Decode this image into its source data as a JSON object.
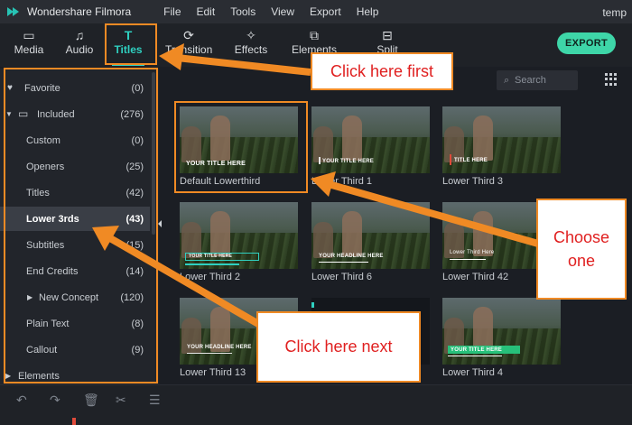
{
  "app": {
    "name": "Wondershare Filmora",
    "project": "temp",
    "menu": [
      "File",
      "Edit",
      "Tools",
      "View",
      "Export",
      "Help"
    ]
  },
  "toolbar": {
    "tabs": [
      {
        "label": "Media",
        "icon": "media-folder-icon"
      },
      {
        "label": "Audio",
        "icon": "music-note-icon"
      },
      {
        "label": "Titles",
        "icon": "text-t-icon",
        "active": true
      },
      {
        "label": "Transition",
        "icon": "transition-icon"
      },
      {
        "label": "Effects",
        "icon": "sparkle-icon"
      },
      {
        "label": "Elements",
        "icon": "elements-icon"
      },
      {
        "label": "Split Screen",
        "icon": "split-screen-icon"
      }
    ],
    "export_label": "EXPORT",
    "accent": "#2fd0c0"
  },
  "sidebar": {
    "items": [
      {
        "label": "Favorite",
        "count": "(0)",
        "icon": "heart-icon"
      },
      {
        "label": "Included",
        "count": "(276)",
        "icon": "folder-icon"
      },
      {
        "label": "Custom",
        "count": "(0)"
      },
      {
        "label": "Openers",
        "count": "(25)"
      },
      {
        "label": "Titles",
        "count": "(42)"
      },
      {
        "label": "Lower 3rds",
        "count": "(43)",
        "selected": true
      },
      {
        "label": "Subtitles",
        "count": "(15)"
      },
      {
        "label": "End Credits",
        "count": "(14)"
      },
      {
        "label": "New Concept",
        "count": "(120)"
      },
      {
        "label": "Plain Text",
        "count": "(8)"
      },
      {
        "label": "Callout",
        "count": "(9)"
      },
      {
        "label": "Elements",
        "count": ""
      }
    ]
  },
  "search": {
    "placeholder": "Search"
  },
  "thumbnails": [
    {
      "label": "Default Lowerthird",
      "overlay": "YOUR TITLE HERE"
    },
    {
      "label": "Lower Third 1",
      "overlay": "YOUR TITLE HERE"
    },
    {
      "label": "Lower Third 3",
      "overlay": "TITLE HERE"
    },
    {
      "label": "Lower Third 2",
      "overlay": "YOUR TITLE HERE"
    },
    {
      "label": "Lower Third 6",
      "overlay": "YOUR HEADLINE HERE"
    },
    {
      "label": "Lower Third 42",
      "overlay": "Lower Third Here"
    },
    {
      "label": "Lower Third 13",
      "overlay": "YOUR HEADLINE HERE"
    },
    {
      "label": "",
      "overlay": ""
    },
    {
      "label": "Lower Third 4",
      "overlay": "YOUR TITLE HERE"
    }
  ],
  "annotations": {
    "first": "Click here first",
    "next": "Click here next",
    "choose": "Choose one",
    "color": "#f08a24",
    "text_color": "#e02020"
  },
  "bottom_icons": [
    "undo-icon",
    "redo-icon",
    "delete-icon",
    "cut-icon",
    "adjust-icon"
  ]
}
